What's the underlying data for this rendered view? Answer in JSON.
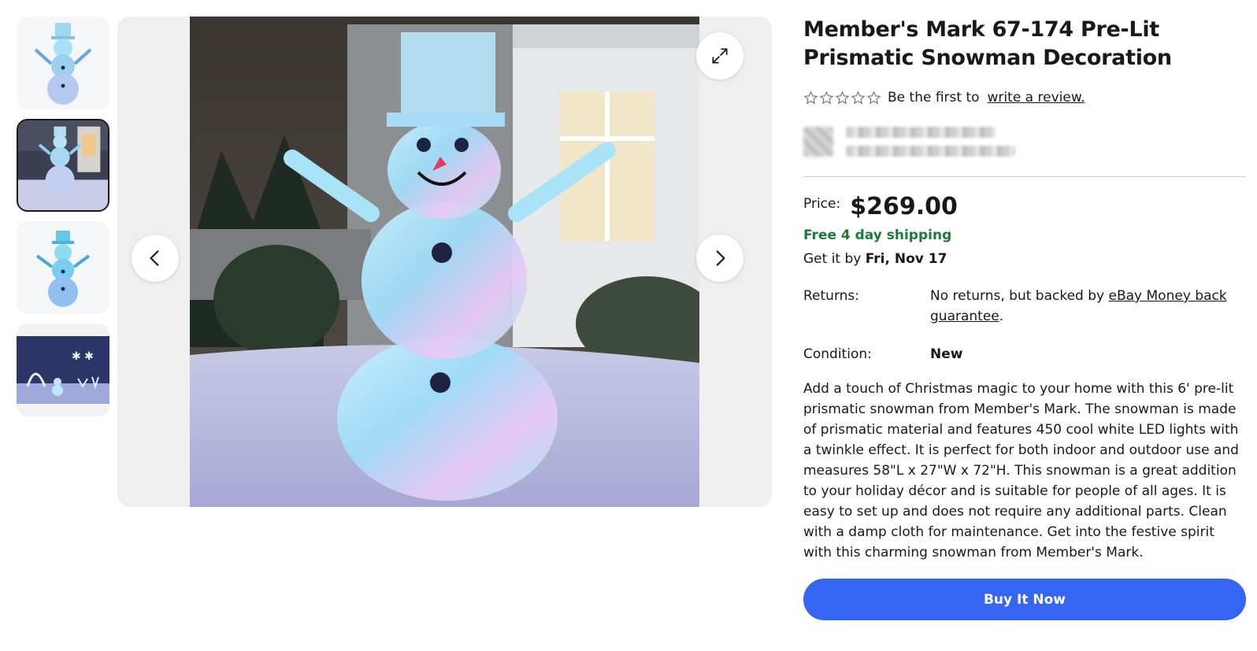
{
  "product": {
    "title": "Member's Mark 67-174 Pre-Lit Prismatic Snowman Decoration"
  },
  "rating": {
    "stars": 0,
    "text": "Be the first to",
    "review_link": "write a review."
  },
  "price": {
    "label": "Price:",
    "value": "$269.00"
  },
  "shipping": {
    "text": "Free 4 day shipping",
    "delivery_prefix": "Get it by",
    "delivery_date": "Fri, Nov 17"
  },
  "returns": {
    "label": "Returns:",
    "text": "No returns, but backed by",
    "link": "eBay Money back guarantee",
    "suffix": "."
  },
  "condition": {
    "label": "Condition:",
    "value": "New"
  },
  "description": "Add a touch of Christmas magic to your home with this 6' pre-lit prismatic snowman from Member's Mark. The snowman is made of prismatic material and features 450 cool white LED lights with a twinkle effect. It is perfect for both indoor and outdoor use and measures 58\"L x 27\"W x 72\"H. This snowman is a great addition to your holiday décor and is suitable for people of all ages. It is easy to set up and does not require any additional parts. Clean with a damp cloth for maintenance. Get into the festive spirit with this charming snowman from Member's Mark.",
  "actions": {
    "buy_now": "Buy It Now"
  },
  "gallery": {
    "thumbnail_count": 4,
    "selected_index": 1,
    "icons": [
      "expand-icon",
      "chevron-left-icon",
      "chevron-right-icon",
      "star-outline-icon"
    ]
  },
  "colors": {
    "accent": "#3665f3",
    "shipping_green": "#1d7a3b",
    "text": "#191919"
  }
}
